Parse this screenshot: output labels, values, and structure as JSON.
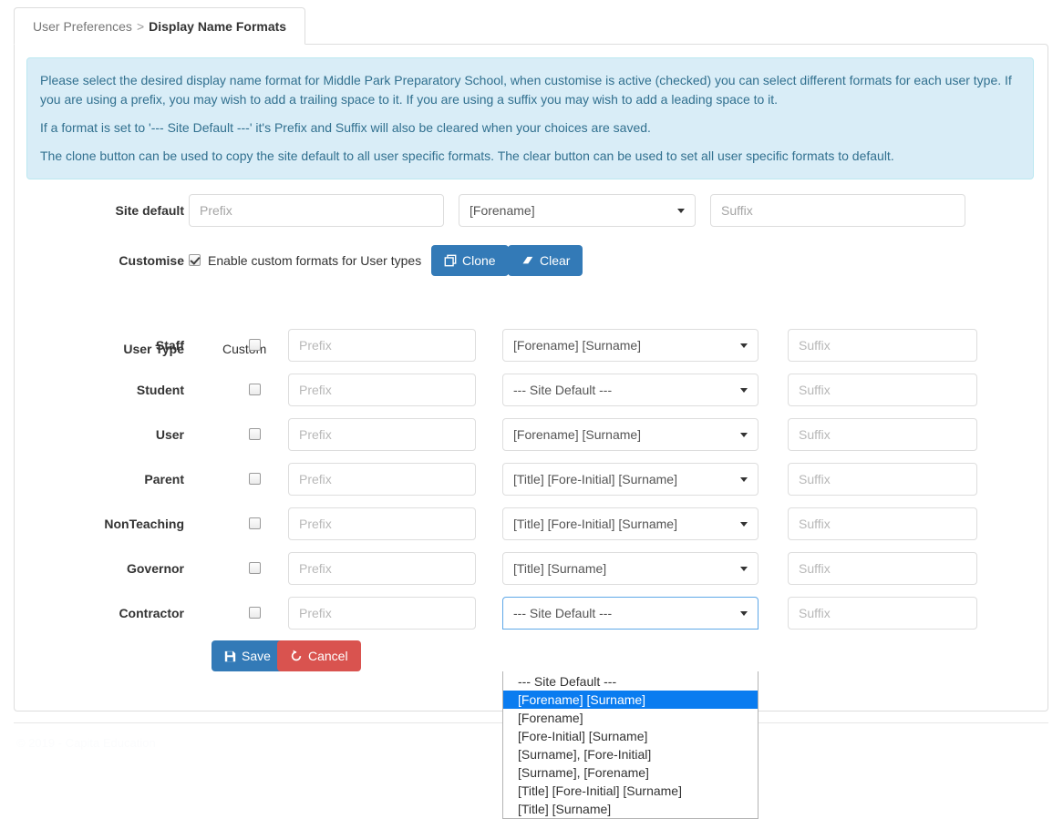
{
  "breadcrumb": {
    "parent": "User Preferences",
    "separator": ">",
    "current": "Display Name Formats"
  },
  "alert": {
    "line1": "Please select the desired display name format for Middle Park Preparatory School, when customise is active (checked) you can select different formats for each user type. If you are using a prefix, you may wish to add a trailing space to it. If you are using a suffix you may wish to add a leading space to it.",
    "line2": "If a format is set to '--- Site Default ---' it's Prefix and Suffix will also be cleared when your choices are saved.",
    "line3": "The clone button can be used to copy the site default to all user specific formats. The clear button can be used to set all user specific formats to default."
  },
  "site_default": {
    "label": "Site default",
    "prefix_placeholder": "Prefix",
    "format_value": "[Forename]",
    "suffix_placeholder": "Suffix"
  },
  "customise": {
    "label": "Customise",
    "checkbox_label": "Enable custom formats for User types",
    "checked": true,
    "clone_label": "Clone",
    "clear_label": "Clear"
  },
  "table": {
    "header_usertype": "User Type",
    "header_custom": "Custom",
    "prefix_placeholder": "Prefix",
    "suffix_placeholder": "Suffix",
    "rows": [
      {
        "label": "Staff",
        "custom": false,
        "format": "[Forename] [Surname]"
      },
      {
        "label": "Student",
        "custom": false,
        "format": "--- Site Default ---"
      },
      {
        "label": "User",
        "custom": false,
        "format": "[Forename] [Surname]"
      },
      {
        "label": "Parent",
        "custom": false,
        "format": "[Title] [Fore-Initial] [Surname]"
      },
      {
        "label": "NonTeaching",
        "custom": false,
        "format": "[Title] [Fore-Initial] [Surname]"
      },
      {
        "label": "Governor",
        "custom": false,
        "format": "[Title] [Surname]"
      },
      {
        "label": "Contractor",
        "custom": false,
        "format": "--- Site Default ---"
      }
    ]
  },
  "dropdown": {
    "open_for_row": "Contractor",
    "selected": "[Forename] [Surname]",
    "options": [
      "--- Site Default ---",
      "[Forename] [Surname]",
      "[Forename]",
      "[Fore-Initial] [Surname]",
      "[Surname], [Fore-Initial]",
      "[Surname], [Forename]",
      "[Title] [Fore-Initial] [Surname]",
      "[Title] [Surname]"
    ]
  },
  "actions": {
    "save_label": "Save",
    "cancel_label": "Cancel"
  },
  "footer": {
    "text": "© 2019 - Capita Education"
  },
  "colors": {
    "primary": "#337ab7",
    "danger": "#d9534f",
    "info_bg": "#d9edf7",
    "info_text": "#31708f",
    "highlight": "#0a7cf0"
  }
}
